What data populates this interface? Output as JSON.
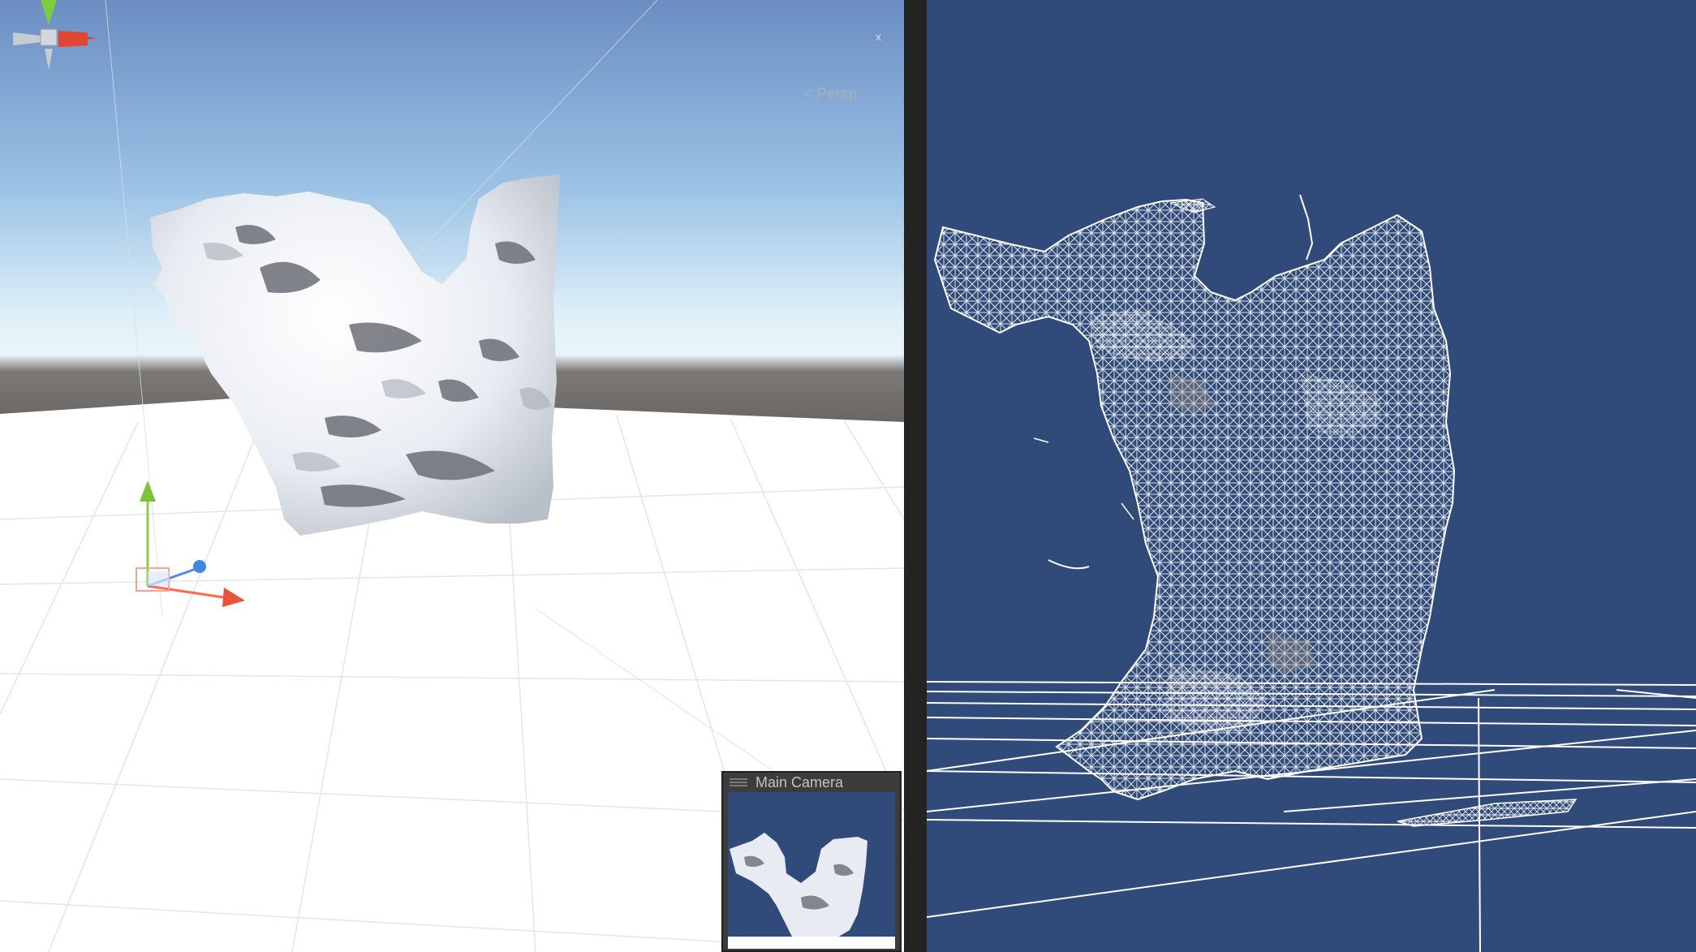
{
  "scene_view": {
    "camera_mode": "Persp",
    "axis_label": "x",
    "gizmo_icon": "orientation-gizmo",
    "sky_colors": [
      "#6d8fc2",
      "#b5d8ef",
      "#e7f4fb",
      "#6e6a68"
    ],
    "ground_color": "#ffffff",
    "mesh_shading": "shaded"
  },
  "camera_preview": {
    "title": "Main Camera",
    "background": "#304b79"
  },
  "game_view": {
    "background": "#304b79",
    "mesh_shading": "wireframe"
  }
}
